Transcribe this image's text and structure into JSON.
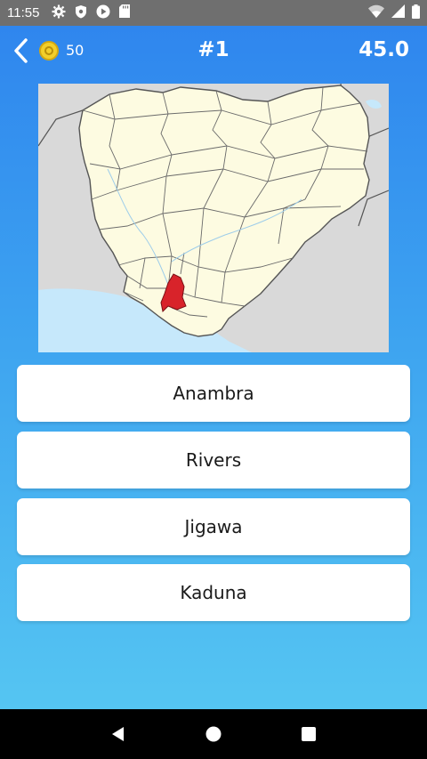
{
  "status_bar": {
    "time": "11:55",
    "icons": [
      "gear-icon",
      "shield-icon",
      "play-circle-icon",
      "sd-card-icon"
    ],
    "right_icons": [
      "wifi-icon",
      "signal-icon",
      "battery-icon"
    ]
  },
  "header": {
    "coins": "50",
    "question_number": "#1",
    "timer": "45.0"
  },
  "map": {
    "subject": "Nigeria states map",
    "highlighted_state_color": "#d8232a",
    "land_color": "#fdfbe1",
    "neighbor_color": "#d6d6d6",
    "water_color": "#c6e8fb"
  },
  "answers": [
    {
      "label": "Anambra"
    },
    {
      "label": "Rivers"
    },
    {
      "label": "Jigawa"
    },
    {
      "label": "Kaduna"
    }
  ],
  "colors": {
    "gradient_top": "#2f86ee",
    "gradient_bottom": "#55c5f2",
    "coin": "#f3cf2a"
  },
  "nav": [
    "back-triangle-icon",
    "home-circle-icon",
    "recents-square-icon"
  ]
}
